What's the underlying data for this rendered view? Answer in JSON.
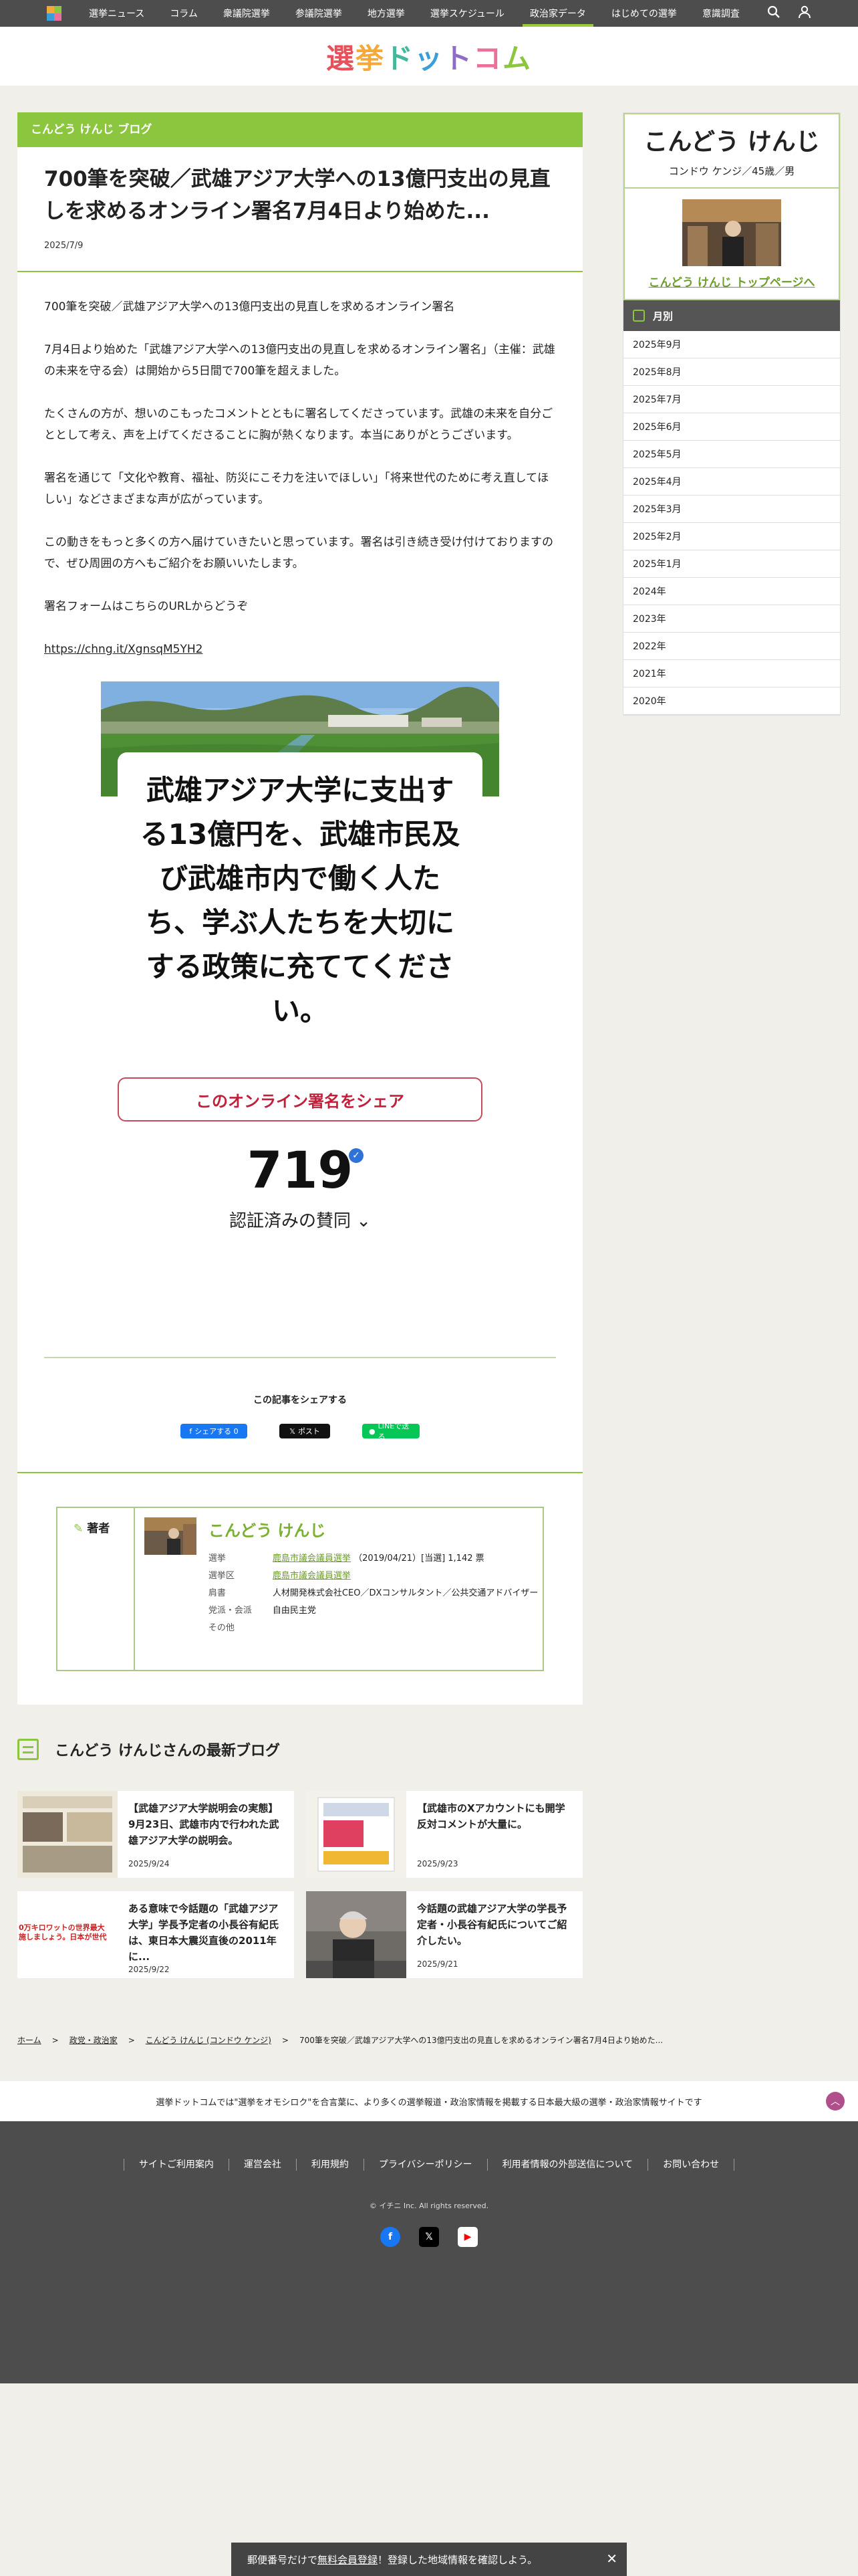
{
  "topnav": {
    "items": [
      "選挙ニュース",
      "コラム",
      "衆議院選挙",
      "参議院選挙",
      "地方選挙",
      "選挙スケジュール",
      "政治家データ",
      "はじめての選挙",
      "意識調査"
    ],
    "active_index": 6
  },
  "brand": {
    "chars": [
      "選",
      "挙",
      "ド",
      "ッ",
      "ト",
      "コ",
      "ム"
    ],
    "colors": [
      "#e8505b",
      "#f4a93b",
      "#43b89c",
      "#3a9ed9",
      "#8e6cc8",
      "#e8709b",
      "#8cc63e"
    ]
  },
  "main": {
    "blog_header": "こんどう けんじ ブログ",
    "title": "700筆を突破／武雄アジア大学への13億円支出の見直しを求めるオンライン署名7月4日より始めた...",
    "date": "2025/7/9",
    "paragraphs": [
      "700筆を突破／武雄アジア大学への13億円支出の見直しを求めるオンライン署名",
      "7月4日より始めた「武雄アジア大学への13億円支出の見直しを求めるオンライン署名」（主催：武雄の未来を守る会）は開始から5日間で700筆を超えました。",
      "たくさんの方が、想いのこもったコメントとともに署名してくださっています。武雄の未来を自分ごととして考え、声を上げてくださることに胸が熱くなります。本当にありがとうございます。",
      "署名を通じて「文化や教育、福祉、防災にこそ力を注いでほしい」「将来世代のために考え直してほしい」などさまざまな声が広がっています。",
      "この動きをもっと多くの方へ届けていきたいと思っています。署名は引き続き受け付けておりますので、ぜひ周囲の方へもご紹介をお願いいたします。",
      "署名フォームはこちらのURLからどうぞ"
    ],
    "url": "https://chng.it/XgnsqM5YH2",
    "petition": {
      "text": "武雄アジア大学に支出する13億円を、武雄市民及び武雄市内で働く人たち、学ぶ人たちを大切にする政策に充ててください。",
      "share_button": "このオンライン署名をシェア",
      "count": "719",
      "verified_label": "認証済みの賛同"
    },
    "share": {
      "title": "この記事をシェアする",
      "facebook": "シェアする 0",
      "x": "ポスト",
      "line": "LINEで送る"
    },
    "author": {
      "label": "著者",
      "name": "こんどう けんじ",
      "rows": [
        {
          "k": "選挙",
          "link": "鹿島市議会議員選挙",
          "v": "（2019/04/21）[当選] 1,142 票"
        },
        {
          "k": "選挙区",
          "link": "鹿島市議会議員選挙",
          "v": ""
        },
        {
          "k": "肩書",
          "link": "",
          "v": "人材開発株式会社CEO／DXコンサルタント／公共交通アドバイザー"
        },
        {
          "k": "党派・会派",
          "link": "",
          "v": "自由民主党"
        },
        {
          "k": "その他",
          "link": "",
          "v": ""
        }
      ]
    }
  },
  "side": {
    "name": "こんどう けんじ",
    "kana": "コンドウ ケンジ／45歳／男",
    "top_link": "こんどう けんじ トップページへ",
    "month_header": "月別",
    "months": [
      "2025年9月",
      "2025年8月",
      "2025年7月",
      "2025年6月",
      "2025年5月",
      "2025年4月",
      "2025年3月",
      "2025年2月",
      "2025年1月",
      "2024年",
      "2023年",
      "2022年",
      "2021年",
      "2020年"
    ]
  },
  "latest": {
    "title": "こんどう けんじさんの最新ブログ",
    "cards": [
      {
        "title": "【武雄アジア大学説明会の実態】9月23日、武雄市内で行われた武雄アジア大学の説明会。",
        "date": "2025/9/24"
      },
      {
        "title": "【武雄市のXアカウントにも開学反対コメントが大量に。",
        "date": "2025/9/23"
      },
      {
        "title": "ある意味で今話題の「武雄アジア大学」学長予定者の小長谷有紀氏は、東日本大震災直後の2011年に...",
        "date": "2025/9/22"
      },
      {
        "title": "今話題の武雄アジア大学の学長予定者・小長谷有紀氏についてご紹介したい。",
        "date": "2025/9/21"
      }
    ],
    "thumb_text": "0万キロワットの世界最大\n施しましょう。日本が世代"
  },
  "crumbs": [
    "ホーム",
    "政党・政治家",
    "こんどう けんじ (コンドウ ケンジ)",
    "700筆を突破／武雄アジア大学への13億円支出の見直しを求めるオンライン署名7月4日より始めた..."
  ],
  "strip": "選挙ドットコムでは\"選挙をオモシロク\"を合言葉に、より多くの選挙報道・政治家情報を掲載する日本最大級の選挙・政治家情報サイトです",
  "footer": {
    "links": [
      "サイトご利用案内",
      "運営会社",
      "利用規約",
      "プライバシーポリシー",
      "利用者情報の外部送信について",
      "お問い合わせ"
    ],
    "copyright": "© イチニ Inc. All rights reserved."
  },
  "bottombar": {
    "link": "無料会員登録",
    "prefix": "郵便番号だけで",
    "suffix": "！登録した地域情報を確認しよう。"
  }
}
